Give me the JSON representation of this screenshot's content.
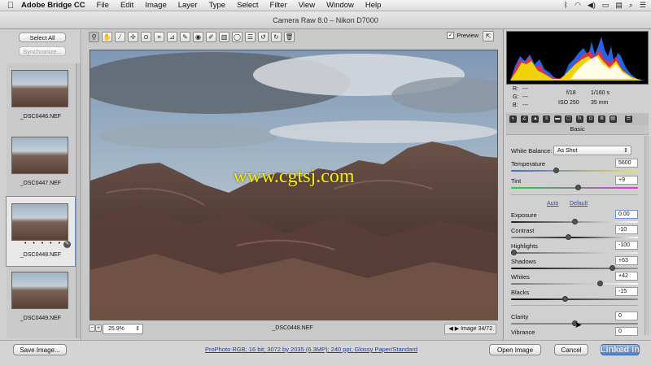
{
  "menubar": {
    "app_name": "Adobe Bridge CC",
    "items": [
      "File",
      "Edit",
      "Image",
      "Layer",
      "Type",
      "Select",
      "Filter",
      "View",
      "Window",
      "Help"
    ]
  },
  "window_title": "Camera Raw 8.0  –  Nikon D7000",
  "left": {
    "select_all": "Select All",
    "synchronize": "Synchronize...",
    "thumbs": [
      {
        "label": "_DSC0446.NEF"
      },
      {
        "label": "_DSC0447.NEF"
      },
      {
        "label": "_DSC0448.NEF",
        "selected": true,
        "rating": "• • • • •"
      },
      {
        "label": "_DSC0449.NEF"
      }
    ]
  },
  "toolbar": {
    "icons": [
      "zoom-icon",
      "hand-icon",
      "white-balance-icon",
      "color-sampler-icon",
      "targeted-adjust-icon",
      "crop-icon",
      "straighten-icon",
      "spot-removal-icon",
      "red-eye-icon",
      "adjustment-brush-icon",
      "graduated-filter-icon",
      "radial-filter-icon",
      "preferences-icon",
      "rotate-ccw-icon",
      "rotate-cw-icon",
      "trash-icon"
    ],
    "preview_label": "Preview",
    "preview_checked": true
  },
  "photo": {
    "watermark": "www.cgtsj.com"
  },
  "status": {
    "zoom": "25.9%",
    "filename": "_DSC0448.NEF",
    "image_count": "Image 34/72"
  },
  "readout": {
    "r": "R:",
    "g": "G:",
    "b": "B:",
    "dash": "---",
    "aperture": "f/18",
    "shutter": "1/160 s",
    "iso": "ISO 250",
    "focal": "35 mm"
  },
  "basic": {
    "title": "Basic",
    "white_balance_label": "White Balance:",
    "white_balance_value": "As Shot",
    "auto": "Auto",
    "default": "Default",
    "sliders": [
      {
        "label": "Temperature",
        "value": "5600",
        "fraction": 0.35,
        "track": "temp"
      },
      {
        "label": "Tint",
        "value": "+9",
        "fraction": 0.53,
        "track": "tint"
      },
      {
        "label": "Exposure",
        "value": "0.00",
        "fraction": 0.5,
        "track": "gray",
        "focus": true
      },
      {
        "label": "Contrast",
        "value": "-10",
        "fraction": 0.45,
        "track": "gray"
      },
      {
        "label": "Highlights",
        "value": "-100",
        "fraction": 0.0,
        "track": "gray"
      },
      {
        "label": "Shadows",
        "value": "+63",
        "fraction": 0.815,
        "track": "gray"
      },
      {
        "label": "Whites",
        "value": "+42",
        "fraction": 0.71,
        "track": "gray"
      },
      {
        "label": "Blacks",
        "value": "-15",
        "fraction": 0.425,
        "track": "gray"
      },
      {
        "label": "Clarity",
        "value": "0",
        "fraction": 0.5,
        "track": "gray"
      },
      {
        "label": "Vibrance",
        "value": "0",
        "fraction": 0.5,
        "track": "gray"
      }
    ]
  },
  "bottom": {
    "save": "Save Image...",
    "workflow": "ProPhoto RGB; 16 bit; 3072 by 2035 (6.3MP); 240 ppi; Glossy Paper/Standard",
    "open": "Open Image",
    "cancel": "Cancel",
    "done": "Done",
    "watermark": "Linked in"
  }
}
